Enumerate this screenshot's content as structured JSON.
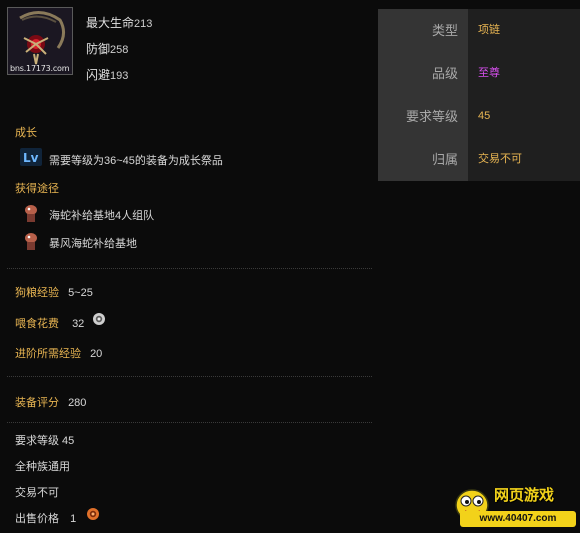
{
  "item": {
    "watermark": "bns.17173.com",
    "stats": [
      {
        "name": "最大生命",
        "value": "213"
      },
      {
        "name": "防御",
        "value": "258"
      },
      {
        "name": "闪避",
        "value": "193"
      }
    ]
  },
  "info": [
    {
      "key": "类型",
      "value": "项链",
      "color": "#e8b552"
    },
    {
      "key": "品级",
      "value": "至尊",
      "color": "#d84ff0"
    },
    {
      "key": "要求等级",
      "value": "45",
      "color": "#e8b552"
    },
    {
      "key": "归属",
      "value": "交易不可",
      "color": "#e8b552"
    }
  ],
  "growth": {
    "title": "成长",
    "text": "需要等级为36~45的装备为成长祭品"
  },
  "obtain": {
    "title": "获得途径",
    "items": [
      "海蛇补给基地4人组队",
      "暴风海蛇补给基地"
    ]
  },
  "pet": {
    "exp_label": "狗粮经验",
    "exp_value": "5~25",
    "feed_label": "喂食花费",
    "feed_value": "32",
    "advance_label": "进阶所需经验",
    "advance_value": "20"
  },
  "score": {
    "label": "装备评分",
    "value": "280"
  },
  "bottom": {
    "req_level": "要求等级  45",
    "race": "全种族通用",
    "trade": "交易不可",
    "price_label": "出售价格",
    "price_value": "1"
  },
  "logo": {
    "title": "网页游戏",
    "site": "www.40407.com"
  },
  "colors": {
    "accent": "#e8b552",
    "legend": "#d84ff0"
  }
}
